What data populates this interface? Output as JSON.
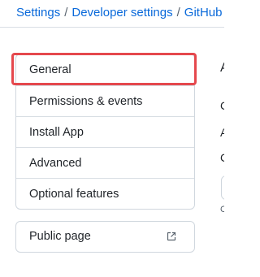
{
  "breadcrumb": {
    "items": [
      "Settings",
      "Developer settings",
      "GitHub Ap"
    ],
    "separator": "/"
  },
  "menu": {
    "items": [
      {
        "label": "General",
        "selected": true
      },
      {
        "label": "Permissions & events",
        "selected": false
      },
      {
        "label": "Install App",
        "selected": false
      },
      {
        "label": "Advanced",
        "selected": false
      },
      {
        "label": "Optional features",
        "selected": false
      }
    ]
  },
  "public_page": {
    "label": "Public page",
    "icon": "external-link-icon"
  },
  "right_panel_fragments": {
    "heading_glyph": "A",
    "line1_glyph": "C",
    "line2_glyph": "A",
    "line3_glyph": "C",
    "line4_glyph": "C"
  },
  "colors": {
    "link": "#0969da",
    "highlight": "#e5484d",
    "border": "#d0d7de"
  }
}
